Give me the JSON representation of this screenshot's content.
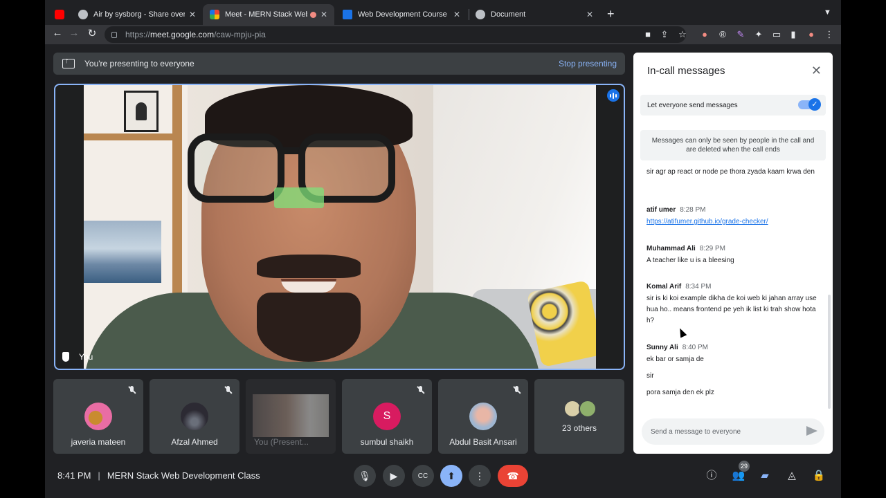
{
  "browser": {
    "tabs": [
      {
        "title": "Air by sysborg - Share over the",
        "favicon_color": "#bdc1c6"
      },
      {
        "title": "Meet - MERN Stack Web D",
        "favicon_color": "#34a853"
      },
      {
        "title": "Web Development Course - Sir",
        "favicon_color": "#1a73e8"
      },
      {
        "title": "Document",
        "favicon_color": "#bdc1c6"
      }
    ],
    "url_prefix": "https://",
    "url_host": "meet.google.com",
    "url_path": "/caw-mpju-pia"
  },
  "presenting": {
    "message": "You're presenting to everyone",
    "stop_label": "Stop presenting"
  },
  "main_video": {
    "label": "You"
  },
  "tiles": [
    {
      "name": "javeria mateen",
      "avatar_color": "#e96da4"
    },
    {
      "name": "Afzal Ahmed",
      "avatar_color": "#2c2a33"
    },
    {
      "name": "You (Present...",
      "avatar_color": "#6b6260"
    },
    {
      "name": "sumbul shaikh",
      "avatar_color": "#d81b60",
      "letter": "S"
    },
    {
      "name": "Abdul Basit Ansari",
      "avatar_color": "#c7a79a"
    },
    {
      "name": "23 others",
      "avatar_color": "#b5c38a"
    }
  ],
  "bottom_bar": {
    "time": "8:41 PM",
    "separator": "|",
    "meeting_title": "MERN Stack Web Development Class",
    "participant_count": "29"
  },
  "chat": {
    "title": "In-call messages",
    "toggle_label": "Let everyone send messages",
    "notice": "Messages can only be seen by people in the call and are deleted when the call ends",
    "messages": [
      {
        "sender": "",
        "time": "",
        "lines": [
          "sir agr ap react or node pe thora zyada kaam krwa den"
        ]
      },
      {
        "sender": "atif umer",
        "time": "8:28 PM",
        "link": "https://atifumer.github.io/grade-checker/"
      },
      {
        "sender": "Muhammad Ali",
        "time": "8:29 PM",
        "lines": [
          "A teacher like u is a bleesing"
        ]
      },
      {
        "sender": "Komal Arif",
        "time": "8:34 PM",
        "lines": [
          "sir is ki koi example dikha de koi web ki jahan array use hua ho.. means frontend pe yeh ik list ki trah show hota h?"
        ]
      },
      {
        "sender": "Sunny Ali",
        "time": "8:40 PM",
        "lines": [
          "ek bar or samja de",
          "sir",
          "pora samja den ek plz"
        ]
      }
    ],
    "input_placeholder": "Send a message to everyone"
  },
  "colors": {
    "accent": "#8ab4f8",
    "hangup": "#ea4335",
    "surface": "#3c4043",
    "background": "#202124"
  }
}
